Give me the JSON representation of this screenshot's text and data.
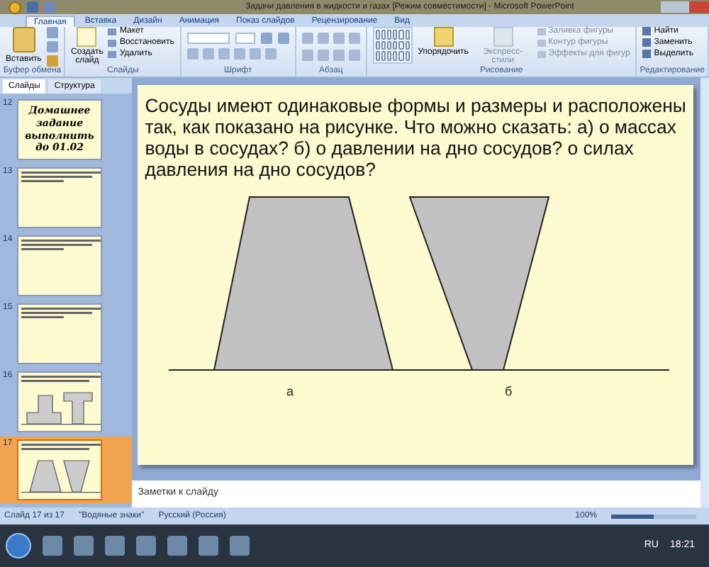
{
  "window": {
    "title": "Задачи давления в жидкости и газах [Режим совместимости] - Microsoft PowerPoint"
  },
  "ribbon_tabs": [
    {
      "label": "Главная",
      "selected": true
    },
    {
      "label": "Вставка",
      "selected": false
    },
    {
      "label": "Дизайн",
      "selected": false
    },
    {
      "label": "Анимация",
      "selected": false
    },
    {
      "label": "Показ слайдов",
      "selected": false
    },
    {
      "label": "Рецензирование",
      "selected": false
    },
    {
      "label": "Вид",
      "selected": false
    }
  ],
  "ribbon_groups": [
    {
      "kind": "clipboard",
      "label": "Буфер обмена",
      "items": [
        "Вставить"
      ]
    },
    {
      "kind": "slides",
      "label": "Слайды",
      "items": [
        "Создать слайд",
        "Макет",
        "Восстановить",
        "Удалить"
      ]
    },
    {
      "kind": "font",
      "label": "Шрифт"
    },
    {
      "kind": "paragraph",
      "label": "Абзац"
    },
    {
      "kind": "drawing",
      "label": "Рисование",
      "items": [
        "Упорядочить",
        "Экспресс-стили",
        "Заливка фигуры",
        "Контур фигуры",
        "Эффекты для фигур"
      ]
    },
    {
      "kind": "editing",
      "label": "Редактирование",
      "items": [
        "Найти",
        "Заменить",
        "Выделить"
      ]
    }
  ],
  "panel_tabs": [
    {
      "label": "Слайды",
      "selected": true
    },
    {
      "label": "Структура",
      "selected": false
    }
  ],
  "thumbnails": [
    {
      "number": "12",
      "kind": "title",
      "text": "Домашнее задание выполнить до 01.02",
      "selected": false
    },
    {
      "number": "13",
      "kind": "text",
      "selected": false
    },
    {
      "number": "14",
      "kind": "text",
      "selected": false
    },
    {
      "number": "15",
      "kind": "text",
      "selected": false
    },
    {
      "number": "16",
      "kind": "t-vessels",
      "selected": false
    },
    {
      "number": "17",
      "kind": "trapezoids",
      "selected": true
    }
  ],
  "slide": {
    "question": "Сосуды имеют одинаковые формы и размеры и расположены так, как показано на рисунке. Что можно сказать: а) о массах воды в сосудах? б) о давлении на дно сосудов? о силах давления на дно сосудов?",
    "labels": [
      "а",
      "б"
    ]
  },
  "notes": {
    "placeholder": "Заметки к слайду"
  },
  "status_bar": {
    "slide": "Слайд 17 из 17",
    "theme": "\"Водяные знаки\"",
    "language": "Русский (Россия)",
    "zoom": "100%",
    "level": 0.5
  },
  "taskbar": {
    "language": "RU",
    "clock": "18:21"
  }
}
